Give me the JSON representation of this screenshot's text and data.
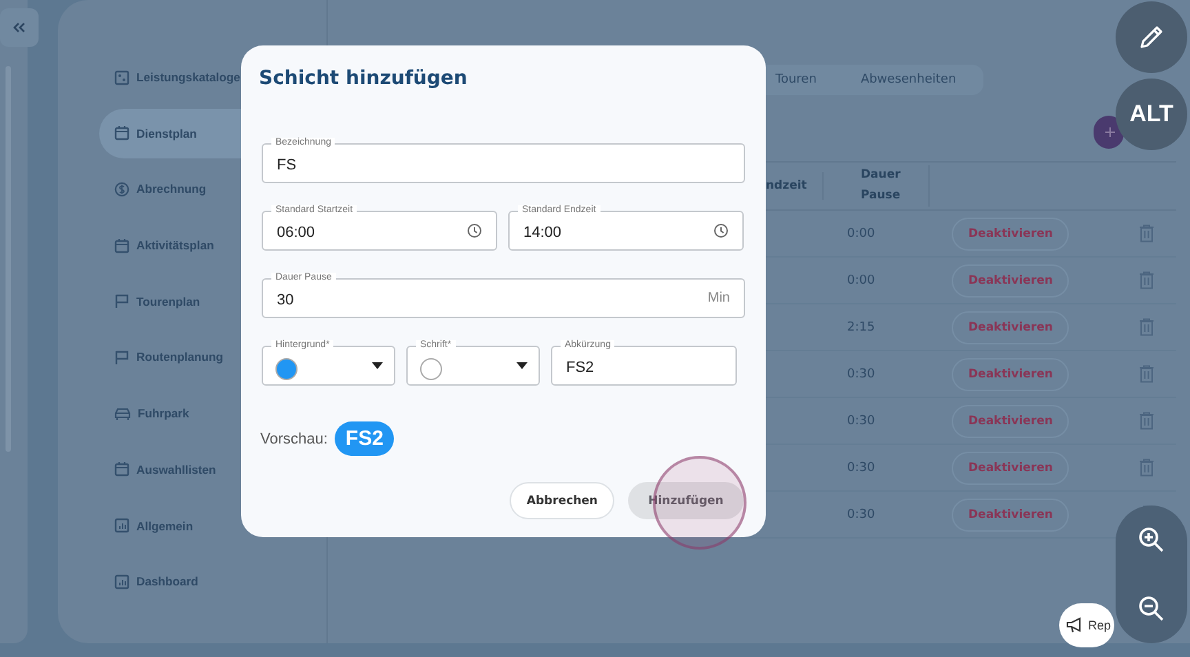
{
  "sidebar": {
    "items": [
      {
        "label": "Leistungskataloge",
        "kind": "grid",
        "selected": false
      },
      {
        "label": "Dienstplan",
        "kind": "calendar",
        "selected": true
      },
      {
        "label": "Abrechnung",
        "kind": "dollar",
        "selected": false
      },
      {
        "label": "Aktivitätsplan",
        "kind": "calendar",
        "selected": false
      },
      {
        "label": "Tourenplan",
        "kind": "flag",
        "selected": false
      },
      {
        "label": "Routenplanung",
        "kind": "flag",
        "selected": false
      },
      {
        "label": "Fuhrpark",
        "kind": "car",
        "selected": false
      },
      {
        "label": "Auswahllisten",
        "kind": "calendar",
        "selected": false
      },
      {
        "label": "Allgemein",
        "kind": "chart",
        "selected": false
      },
      {
        "label": "Dashboard",
        "kind": "chart",
        "selected": false
      }
    ]
  },
  "tabs": [
    {
      "label": "Touren",
      "selected": false
    },
    {
      "label": "Abwesenheiten",
      "selected": false
    }
  ],
  "table": {
    "columns": [
      "ndzeit",
      "Dauer Pause"
    ],
    "rows": [
      {
        "pause": "0:00",
        "action": "Deaktivieren"
      },
      {
        "pause": "0:00",
        "action": "Deaktivieren"
      },
      {
        "pause": "2:15",
        "action": "Deaktivieren"
      },
      {
        "pause": "0:30",
        "action": "Deaktivieren"
      },
      {
        "pause": "0:30",
        "action": "Deaktivieren"
      },
      {
        "pause": "0:30",
        "action": "Deaktivieren"
      },
      {
        "pause": "0:30",
        "action": "Deaktivieren"
      }
    ]
  },
  "dialog": {
    "title": "Schicht hinzufügen",
    "name_field": {
      "label": "Bezeichnung",
      "value": "FS"
    },
    "start_field": {
      "label": "Standard Startzeit",
      "value": "06:00"
    },
    "end_field": {
      "label": "Standard Endzeit",
      "value": "14:00"
    },
    "pause_field": {
      "label": "Dauer Pause",
      "value": "30",
      "unit": "Min"
    },
    "background_select": {
      "label": "Hintergrund*",
      "color": "#2196f3"
    },
    "font_select": {
      "label": "Schrift*",
      "color": "#ffffff"
    },
    "abbreviation_field": {
      "label": "Abkürzung",
      "value": "FS2"
    },
    "preview": {
      "label": "Vorschau:",
      "badge": "FS2"
    },
    "buttons": [
      {
        "label": "Abbrechen",
        "kind": "secondary"
      },
      {
        "label": "Hinzufügen",
        "kind": "primary",
        "disabled": true
      }
    ]
  },
  "floating": {
    "alt_label": "ALT",
    "report_label": "Rep"
  }
}
